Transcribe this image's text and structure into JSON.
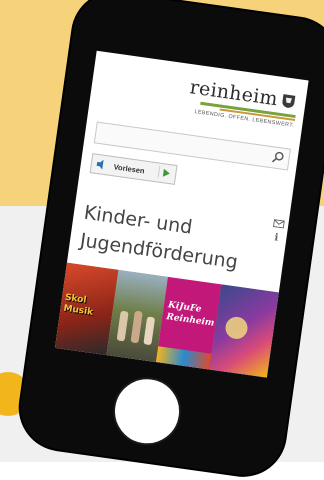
{
  "colors": {
    "background_yellow": "#f6d27a",
    "background_lower": "#f0f0f0",
    "accent_circle": "#f2b51c",
    "phone_body": "#0b0b0b",
    "logo_green": "#7aa23c"
  },
  "site": {
    "logo_text": "reinheim",
    "slogan": "LEBENDIG. OFFEN. LEBENSWERT."
  },
  "toolbar": {
    "read_aloud_label": "Vorlesen"
  },
  "page": {
    "title_line1": "Kinder- und",
    "title_line2": "Jugendförderung"
  },
  "tiles": [
    {
      "text": "Skol Musik"
    },
    {
      "text": ""
    },
    {
      "text": "KiJuFe Reinheim"
    },
    {
      "text": ""
    }
  ],
  "icons": {
    "search": "search-icon",
    "speaker": "speaker-icon",
    "play": "play-icon",
    "mail": "mail-icon",
    "info": "info-icon",
    "crest": "crest-icon"
  }
}
